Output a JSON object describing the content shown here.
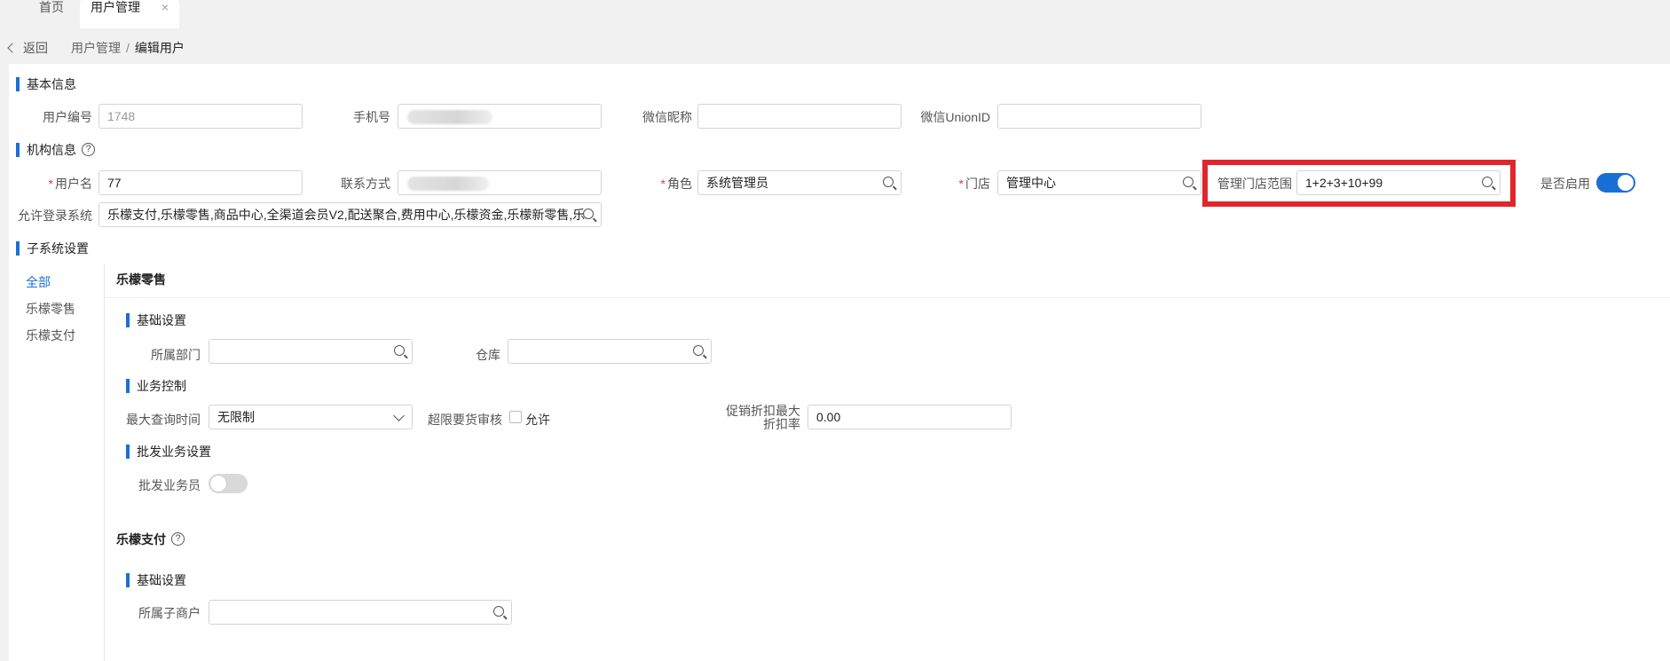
{
  "tabs": {
    "home": "首页",
    "user_mgmt": "用户管理",
    "close": "×"
  },
  "breadcrumb": {
    "back": "返回",
    "parent": "用户管理",
    "separator": "/",
    "current": "编辑用户"
  },
  "basic": {
    "title": "基本信息",
    "user_no_label": "用户编号",
    "user_no_value": "1748",
    "phone_label": "手机号",
    "wechat_nick_label": "微信昵称",
    "wechat_nick_value": "",
    "unionid_label": "微信UnionID",
    "unionid_value": ""
  },
  "org": {
    "title": "机构信息",
    "required_mark": "*",
    "username_label": "用户名",
    "username_value": "77",
    "contact_label": "联系方式",
    "role_label": "角色",
    "role_value": "系统管理员",
    "store_label": "门店",
    "store_value": "管理中心",
    "scope_label": "管理门店范围",
    "scope_value": "1+2+3+10+99",
    "enabled_label": "是否启用",
    "enabled": true,
    "login_sys_label": "允许登录系统",
    "login_sys_value": "乐檬支付,乐檬零售,商品中心,全渠道会员V2,配送聚合,费用中心,乐檬资金,乐檬新零售,乐"
  },
  "subsystem": {
    "title": "子系统设置",
    "nav": [
      "全部",
      "乐檬零售",
      "乐檬支付"
    ],
    "retail": {
      "title": "乐檬零售",
      "basic_title": "基础设置",
      "dept_label": "所属部门",
      "dept_value": "",
      "warehouse_label": "仓库",
      "warehouse_value": "",
      "biz_title": "业务控制",
      "max_query_label": "最大查询时间",
      "max_query_value": "无限制",
      "over_limit_label": "超限要货审核",
      "allow_label": "允许",
      "allow_checked": false,
      "discount_label_1": "促销折扣最大",
      "discount_label_2": "折扣率",
      "discount_value": "0.00",
      "wholesale_title": "批发业务设置",
      "wholesale_label": "批发业务员",
      "wholesale_enabled": false
    },
    "pay": {
      "title": "乐檬支付",
      "basic_title": "基础设置",
      "merchant_label": "所属子商户",
      "merchant_value": ""
    }
  },
  "colors": {
    "accent": "#1a6fd6",
    "required": "#e53935",
    "highlight": "#e0262c"
  }
}
